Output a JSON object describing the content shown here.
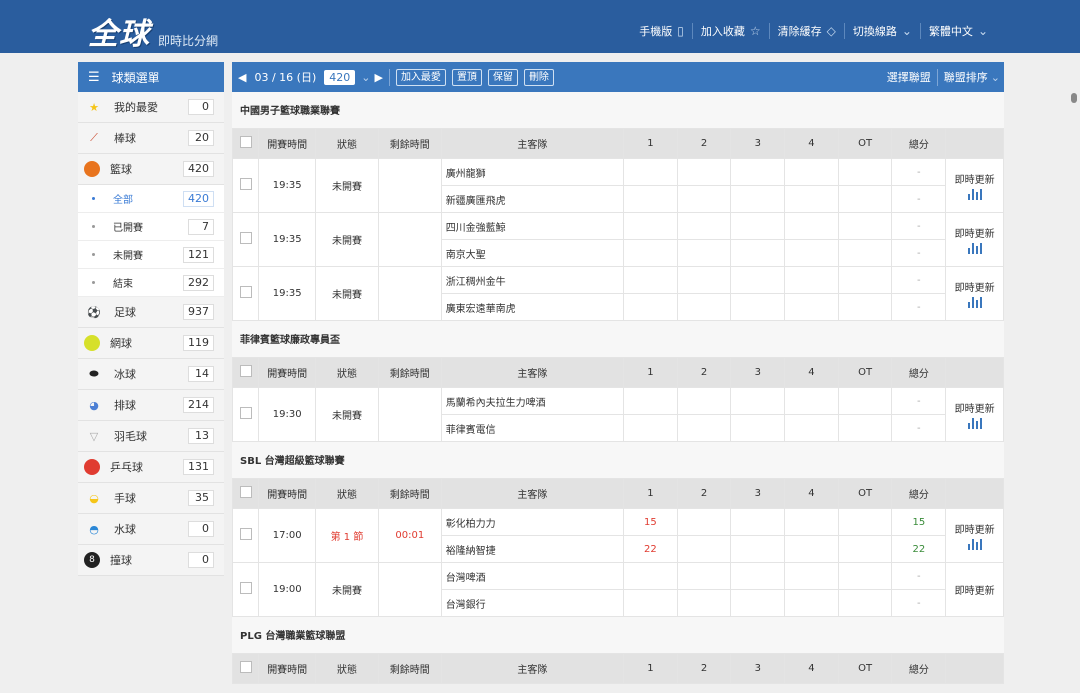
{
  "header": {
    "logo": "全球",
    "logo_sub": "即時比分網",
    "nav": [
      {
        "label": "手機版",
        "icon": "mobile-icon"
      },
      {
        "label": "加入收藏",
        "icon": "star-icon"
      },
      {
        "label": "清除緩存",
        "icon": "eraser-icon"
      },
      {
        "label": "切換線路",
        "icon": "chevron-down-icon"
      },
      {
        "label": "繁體中文",
        "icon": "chevron-down-icon"
      }
    ]
  },
  "sidebar": {
    "title": "球類選單",
    "items": [
      {
        "label": "我的最愛",
        "count": "0",
        "icon": "star-icon",
        "color": "#f5c518"
      },
      {
        "label": "棒球",
        "count": "20",
        "icon": "baseball-bat-icon",
        "color": "#c9472b"
      },
      {
        "label": "籃球",
        "count": "420",
        "icon": "basketball-icon",
        "color": "#e8741e"
      }
    ],
    "basketball_sub": [
      {
        "label": "全部",
        "count": "420",
        "active": true
      },
      {
        "label": "已開賽",
        "count": "7"
      },
      {
        "label": "未開賽",
        "count": "121"
      },
      {
        "label": "結束",
        "count": "292"
      }
    ],
    "items2": [
      {
        "label": "足球",
        "count": "937",
        "icon": "soccer-icon",
        "color": "#222222"
      },
      {
        "label": "網球",
        "count": "119",
        "icon": "tennis-icon",
        "color": "#d6e02a"
      },
      {
        "label": "冰球",
        "count": "14",
        "icon": "hockey-puck-icon",
        "color": "#222222"
      },
      {
        "label": "排球",
        "count": "214",
        "icon": "volleyball-icon",
        "color": "#4c7fd4"
      },
      {
        "label": "羽毛球",
        "count": "13",
        "icon": "shuttlecock-icon",
        "color": "#aaaaaa"
      },
      {
        "label": "乒乓球",
        "count": "131",
        "icon": "ping-pong-icon",
        "color": "#e03c31"
      },
      {
        "label": "手球",
        "count": "35",
        "icon": "handball-icon",
        "color": "#f5c518"
      },
      {
        "label": "水球",
        "count": "0",
        "icon": "water-polo-icon",
        "color": "#2b87d6"
      },
      {
        "label": "撞球",
        "count": "0",
        "icon": "billiard-icon",
        "color": "#222222"
      }
    ]
  },
  "toolbar": {
    "date": "03 / 16 (日)",
    "count": "420",
    "buttons": [
      "加入最愛",
      "置頂",
      "保留",
      "刪除"
    ],
    "select_league": "選擇聯盟",
    "sort_league": "聯盟排序"
  },
  "columns": [
    "開賽時間",
    "狀態",
    "剩餘時間",
    "主客隊",
    "1",
    "2",
    "3",
    "4",
    "OT",
    "總分"
  ],
  "live_label": "即時更新",
  "leagues": [
    {
      "name": "中國男子籃球職業聯賽",
      "matches": [
        {
          "time": "19:35",
          "status": "未開賽",
          "remain": "",
          "home": "廣州龍獅",
          "away": "新疆廣匯飛虎",
          "h1": "",
          "a1": "",
          "htotal": "-",
          "atotal": "-",
          "chart": true
        },
        {
          "time": "19:35",
          "status": "未開賽",
          "remain": "",
          "home": "四川金強藍鯨",
          "away": "南京大聖",
          "h1": "",
          "a1": "",
          "htotal": "-",
          "atotal": "-",
          "chart": true
        },
        {
          "time": "19:35",
          "status": "未開賽",
          "remain": "",
          "home": "浙江稠州金牛",
          "away": "廣東宏遠華南虎",
          "h1": "",
          "a1": "",
          "htotal": "-",
          "atotal": "-",
          "chart": true
        }
      ]
    },
    {
      "name": "菲律賓籃球廉政專員盃",
      "matches": [
        {
          "time": "19:30",
          "status": "未開賽",
          "remain": "",
          "home": "馬蘭希內夫拉生力啤酒",
          "away": "菲律賓電信",
          "h1": "",
          "a1": "",
          "htotal": "-",
          "atotal": "-",
          "chart": true
        }
      ]
    },
    {
      "name": "SBL 台灣超級籃球聯賽",
      "matches": [
        {
          "time": "17:00",
          "status": "第 1 節",
          "remain": "00:01",
          "home": "彰化柏力力",
          "away": "裕隆納智捷",
          "h1": "15",
          "a1": "22",
          "htotal": "15",
          "atotal": "22",
          "chart": true,
          "live": true
        },
        {
          "time": "19:00",
          "status": "未開賽",
          "remain": "",
          "home": "台灣啤酒",
          "away": "台灣銀行",
          "h1": "",
          "a1": "",
          "htotal": "-",
          "atotal": "-",
          "chart": false
        }
      ]
    },
    {
      "name": "PLG 台灣職業籃球聯盟",
      "matches": []
    }
  ]
}
